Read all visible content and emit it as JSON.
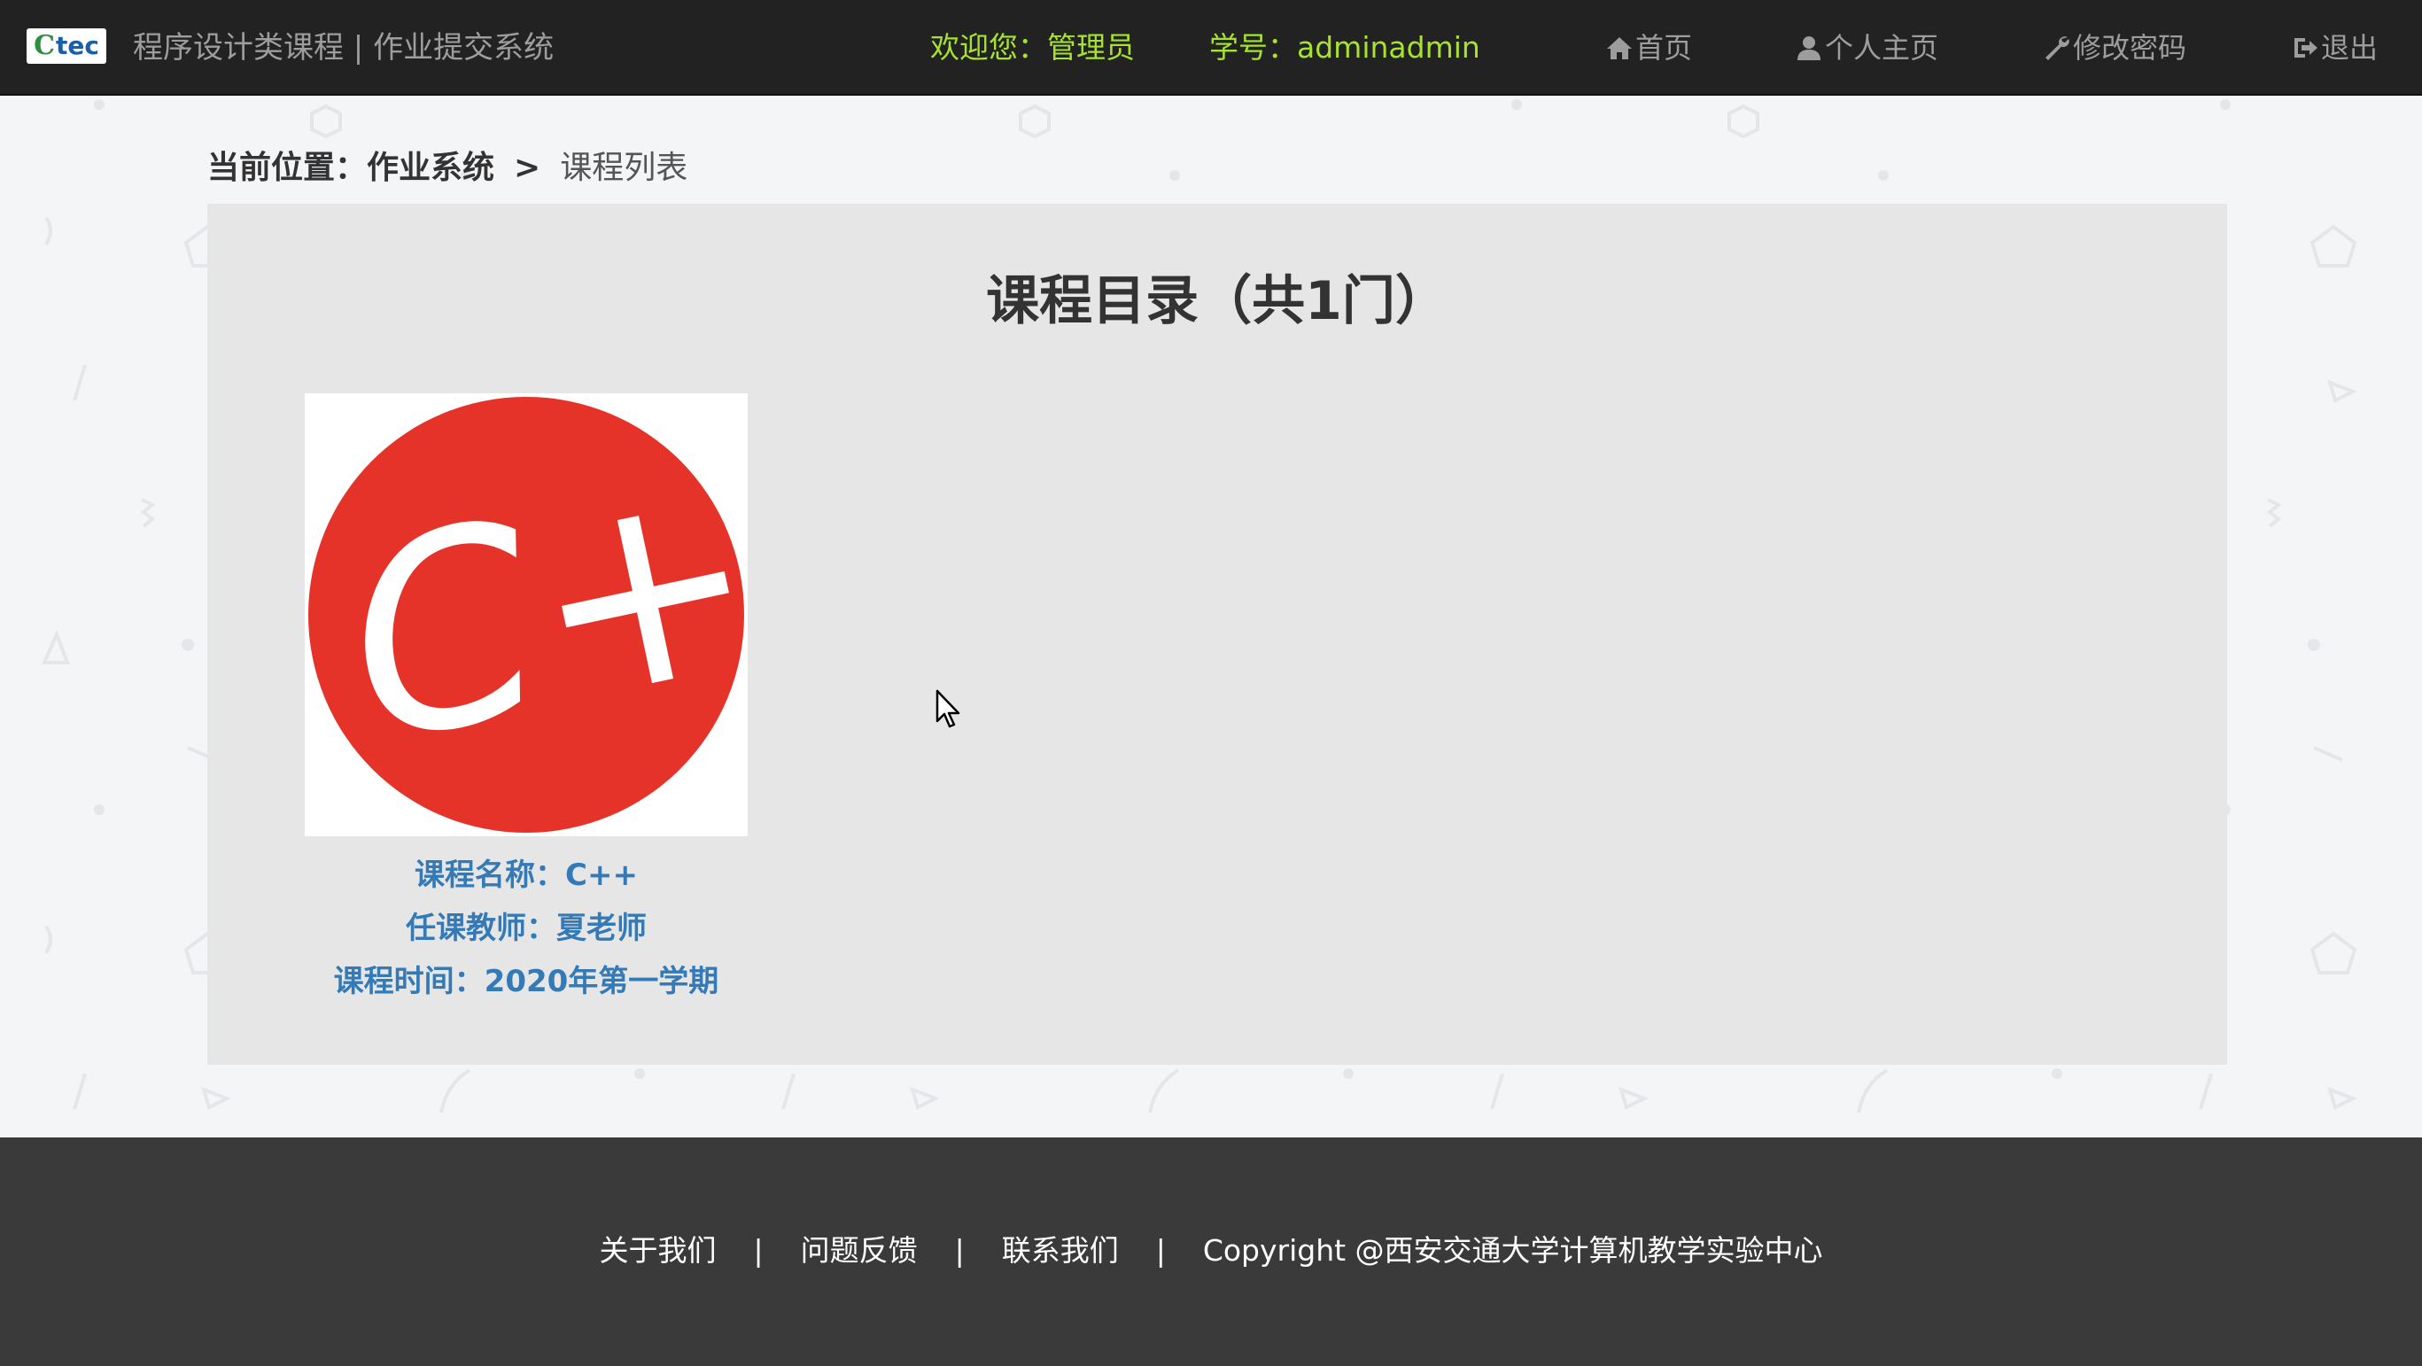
{
  "header": {
    "logo_text_c": "C",
    "logo_text_rest": "tec",
    "site_title": "程序设计类课程 | 作业提交系统",
    "welcome": "欢迎您：管理员",
    "student_id": "学号：adminadmin",
    "nav": {
      "home": "首页",
      "profile": "个人主页",
      "password": "修改密码",
      "logout": "退出"
    }
  },
  "breadcrumb": {
    "prefix": "当前位置：作业系统",
    "separator": ">",
    "current": "课程列表"
  },
  "catalog": {
    "title": "课程目录（共1门）",
    "courses": [
      {
        "logo_text": "C++",
        "name": "课程名称：C++",
        "teacher": "任课教师：夏老师",
        "term": "课程时间：2020年第一学期"
      }
    ]
  },
  "footer": {
    "about": "关于我们",
    "feedback": "问题反馈",
    "contact": "联系我们",
    "separator": "|",
    "copyright": "Copyright @西安交通大学计算机教学实验中心"
  },
  "colors": {
    "navbar_bg": "#222222",
    "accent_green": "#a6e22e",
    "link_blue": "#337ab7",
    "cpp_red": "#e5332a",
    "footer_bg": "#3a3a3a"
  },
  "icons": [
    "home-icon",
    "user-icon",
    "wrench-icon",
    "sign-out-icon",
    "mouse-cursor-icon"
  ]
}
